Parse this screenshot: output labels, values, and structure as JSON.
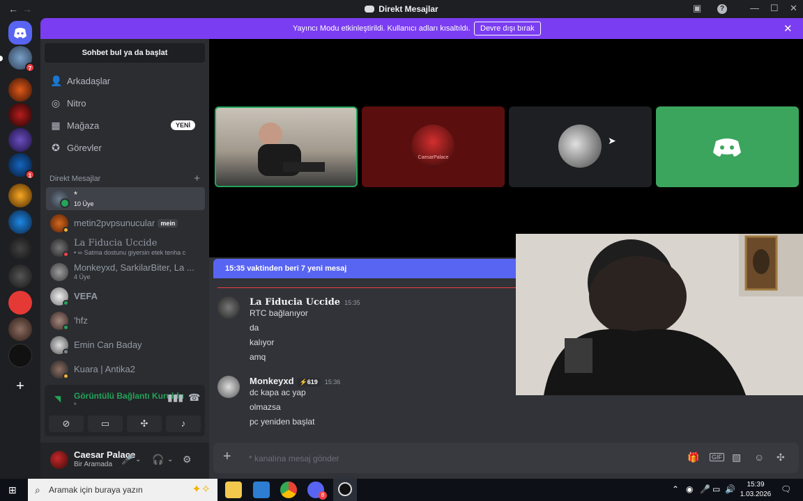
{
  "window": {
    "title": "Direkt Mesajlar",
    "back": "←",
    "forward": "→"
  },
  "banner": {
    "text": "Yayıncı Modu etkinleştirildi. Kullanıcı adları kısaltıldı.",
    "button": "Devre dışı bırak",
    "close": "✕"
  },
  "servers": {
    "dm_badge": "7",
    "metin_badge": "1"
  },
  "sidebar": {
    "search_button": "Sohbet bul ya da başlat",
    "nav": [
      {
        "label": "Arkadaşlar",
        "icon": "friends-icon"
      },
      {
        "label": "Nitro",
        "icon": "nitro-icon"
      },
      {
        "label": "Mağaza",
        "icon": "shop-icon",
        "badge": "YENİ"
      },
      {
        "label": "Görevler",
        "icon": "quests-icon"
      }
    ],
    "dm_header": "Direkt Mesajlar",
    "dm_add": "+",
    "dms": [
      {
        "name": "*",
        "sub": "10 Üye"
      },
      {
        "name": "metin2pvpsunucular",
        "tag": "mein"
      },
      {
        "name": "La Fiducia Uccide",
        "sub": "• ∞  Satma dostunu giyersin etek tenha c"
      },
      {
        "name": "Monkeyxd, SarkilarBiter, La ...",
        "sub": "4 Üye"
      },
      {
        "name": "VEFA"
      },
      {
        "name": "'hfz"
      },
      {
        "name": "Emin Can Baday"
      },
      {
        "name": "Kuara | Antika2"
      }
    ]
  },
  "voice": {
    "status": "Görüntülü Bağlantı Kuruldu",
    "channel": "*"
  },
  "user": {
    "name": "Caesar Palace",
    "status": "Bir Aramada"
  },
  "call": {
    "tile2_label": "CaesarPalace"
  },
  "chat": {
    "new_messages": "15:35 vaktinden beri 7 yeni mesaj",
    "messages": [
      {
        "author": "La Fiducia Uccide",
        "time": "15:35",
        "lines": [
          "RTC bağlanıyor",
          "da",
          "kalıyor",
          "amq"
        ]
      },
      {
        "author": "Monkeyxd",
        "time": "15:36",
        "tag": "619",
        "lines": [
          "dc kapa ac yap",
          "olmazsa",
          "pc yeniden başlat"
        ]
      }
    ],
    "composer_placeholder": "* kanalına mesaj gönder"
  },
  "taskbar": {
    "search_placeholder": "Aramak için buraya yazın",
    "time": "15:39",
    "date": "1.03.2026",
    "chrome_badge": "8"
  },
  "colors": {
    "accent": "#5865f2",
    "banner": "#7b3df1",
    "online": "#23a55a",
    "danger": "#f23f43"
  }
}
